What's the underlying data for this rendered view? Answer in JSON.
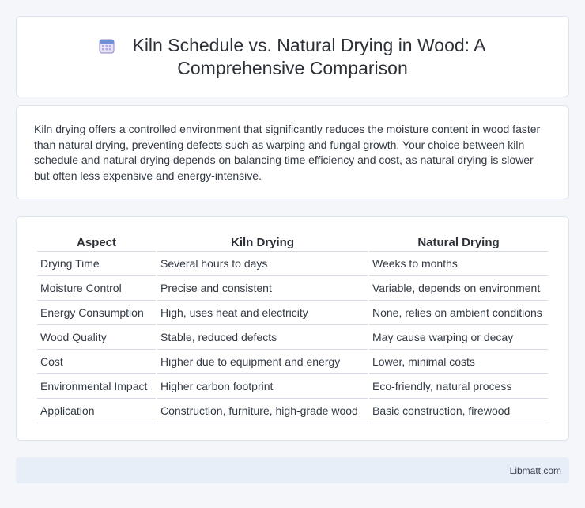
{
  "header": {
    "title": "Kiln Schedule vs. Natural Drying in Wood: A Comprehensive Comparison",
    "icon": "calendar-icon"
  },
  "intro": {
    "text": "Kiln drying offers a controlled environment that significantly reduces the moisture content in wood faster than natural drying, preventing defects such as warping and fungal growth. Your choice between kiln schedule and natural drying depends on balancing time efficiency and cost, as natural drying is slower but often less expensive and energy-intensive."
  },
  "table": {
    "headers": [
      "Aspect",
      "Kiln Drying",
      "Natural Drying"
    ],
    "rows": [
      [
        "Drying Time",
        "Several hours to days",
        "Weeks to months"
      ],
      [
        "Moisture Control",
        "Precise and consistent",
        "Variable, depends on environment"
      ],
      [
        "Energy Consumption",
        "High, uses heat and electricity",
        "None, relies on ambient conditions"
      ],
      [
        "Wood Quality",
        "Stable, reduced defects",
        "May cause warping or decay"
      ],
      [
        "Cost",
        "Higher due to equipment and energy",
        "Lower, minimal costs"
      ],
      [
        "Environmental Impact",
        "Higher carbon footprint",
        "Eco-friendly, natural process"
      ],
      [
        "Application",
        "Construction, furniture, high-grade wood",
        "Basic construction, firewood"
      ]
    ]
  },
  "footer": {
    "text": "Libmatt.com"
  }
}
